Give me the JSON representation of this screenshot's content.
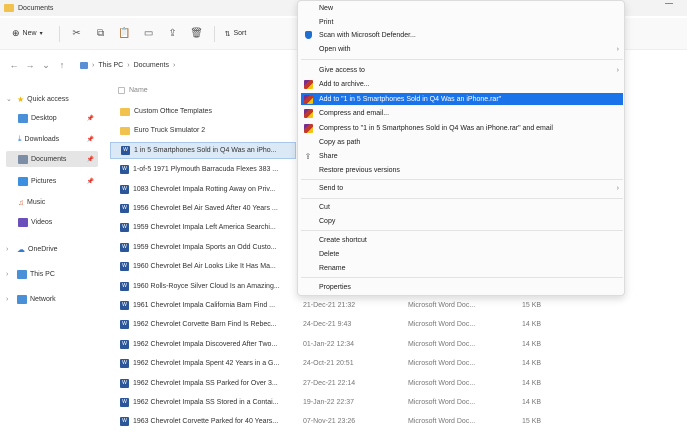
{
  "window": {
    "title": "Documents"
  },
  "toolbar": {
    "new_label": "New",
    "sort_label": "Sort"
  },
  "address": {
    "crumbs": [
      "This PC",
      "Documents"
    ]
  },
  "sidebar": {
    "quick_access": "Quick access",
    "items": [
      "Desktop",
      "Downloads",
      "Documents",
      "Pictures",
      "Music",
      "Videos"
    ],
    "onedrive": "OneDrive",
    "this_pc": "This PC",
    "network": "Network"
  },
  "files": {
    "header_name": "Name",
    "rows": [
      {
        "name": "Custom Office Templates",
        "date": "",
        "type": "",
        "size": ""
      },
      {
        "name": "Euro Truck Simulator 2",
        "date": "",
        "type": "",
        "size": ""
      },
      {
        "name": "1 in 5 Smartphones Sold in Q4 Was an iPho...",
        "date": "",
        "type": "",
        "size": ""
      },
      {
        "name": "1-of-5 1971 Plymouth Barracuda Flexes 383 ...",
        "date": "",
        "type": "",
        "size": ""
      },
      {
        "name": "1083 Chevrolet Impala Rotting Away on Priv...",
        "date": "",
        "type": "",
        "size": ""
      },
      {
        "name": "1956 Chevrolet Bel Air Saved After 40 Years ...",
        "date": "",
        "type": "",
        "size": ""
      },
      {
        "name": "1959 Chevrolet Impala Left America Searchi...",
        "date": "",
        "type": "",
        "size": ""
      },
      {
        "name": "1959 Chevrolet Impala Sports an Odd Custo...",
        "date": "",
        "type": "",
        "size": ""
      },
      {
        "name": "1960 Chevrolet Bel Air Looks Like It Has Ma...",
        "date": "",
        "type": "",
        "size": ""
      },
      {
        "name": "1960 Rolls-Royce Silver Cloud Is an Amazing...",
        "date": "",
        "type": "",
        "size": ""
      },
      {
        "name": "1961 Chevrolet Impala California Barn Find ...",
        "date": "21-Dec-21 21:32",
        "type": "Microsoft Word Doc...",
        "size": "15 KB"
      },
      {
        "name": "1962 Chevrolet Corvette Barn Find Is Rebec...",
        "date": "24-Dec-21 9:43",
        "type": "Microsoft Word Doc...",
        "size": "14 KB"
      },
      {
        "name": "1962 Chevrolet Impala Discovered After Two...",
        "date": "01-Jan-22 12:34",
        "type": "Microsoft Word Doc...",
        "size": "14 KB"
      },
      {
        "name": "1962 Chevrolet Impala Spent 42 Years in a G...",
        "date": "24-Oct-21 20:51",
        "type": "Microsoft Word Doc...",
        "size": "14 KB"
      },
      {
        "name": "1962 Chevrolet Impala SS Parked for Over 3...",
        "date": "27-Dec-21 22:14",
        "type": "Microsoft Word Doc...",
        "size": "14 KB"
      },
      {
        "name": "1962 Chevrolet Impala SS Stored in a Contai...",
        "date": "19-Jan-22 22:37",
        "type": "Microsoft Word Doc...",
        "size": "14 KB"
      },
      {
        "name": "1963 Chevrolet Corvette Parked for 40 Years...",
        "date": "07-Nov-21 23:26",
        "type": "Microsoft Word Doc...",
        "size": "15 KB"
      }
    ]
  },
  "context_menu": {
    "new": "New",
    "print": "Print",
    "scan": "Scan with Microsoft Defender...",
    "open_with": "Open with",
    "give_access": "Give access to",
    "add_archive": "Add to archive...",
    "add_rar": "Add to \"1 in 5 Smartphones Sold in Q4 Was an iPhone.rar\"",
    "compress_email": "Compress and email...",
    "compress_rar_email": "Compress to \"1 in 5 Smartphones Sold in Q4 Was an iPhone.rar\" and email",
    "copy_path": "Copy as path",
    "share": "Share",
    "restore": "Restore previous versions",
    "send_to": "Send to",
    "cut": "Cut",
    "copy": "Copy",
    "create_shortcut": "Create shortcut",
    "delete": "Delete",
    "rename": "Rename",
    "properties": "Properties"
  }
}
